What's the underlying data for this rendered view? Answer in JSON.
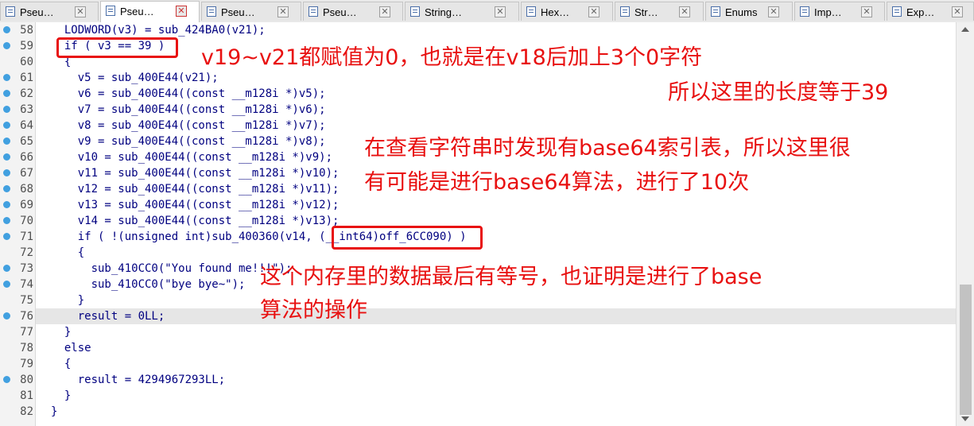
{
  "tabs": [
    {
      "label": "Pseu…",
      "active": false
    },
    {
      "label": "Pseu…",
      "active": true
    },
    {
      "label": "Pseu…",
      "active": false
    },
    {
      "label": "Pseu…",
      "active": false
    },
    {
      "label": "String…",
      "active": false
    },
    {
      "label": "Hex…",
      "active": false
    },
    {
      "label": "Str…",
      "active": false
    },
    {
      "label": "Enums",
      "active": false
    },
    {
      "label": "Imp…",
      "active": false
    },
    {
      "label": "Exp…",
      "active": false
    }
  ],
  "tab_close_glyph": "✕",
  "code_lines": [
    {
      "num": "58",
      "text": "  LODWORD(v3) = sub_424BA0(v21);",
      "bp": true
    },
    {
      "num": "59",
      "text": "  if ( v3 == 39 )",
      "bp": true
    },
    {
      "num": "60",
      "text": "  {",
      "bp": false
    },
    {
      "num": "61",
      "text": "    v5 = sub_400E44(v21);",
      "bp": true
    },
    {
      "num": "62",
      "text": "    v6 = sub_400E44((const __m128i *)v5);",
      "bp": true
    },
    {
      "num": "63",
      "text": "    v7 = sub_400E44((const __m128i *)v6);",
      "bp": true
    },
    {
      "num": "64",
      "text": "    v8 = sub_400E44((const __m128i *)v7);",
      "bp": true
    },
    {
      "num": "65",
      "text": "    v9 = sub_400E44((const __m128i *)v8);",
      "bp": true
    },
    {
      "num": "66",
      "text": "    v10 = sub_400E44((const __m128i *)v9);",
      "bp": true
    },
    {
      "num": "67",
      "text": "    v11 = sub_400E44((const __m128i *)v10);",
      "bp": true
    },
    {
      "num": "68",
      "text": "    v12 = sub_400E44((const __m128i *)v11);",
      "bp": true
    },
    {
      "num": "69",
      "text": "    v13 = sub_400E44((const __m128i *)v12);",
      "bp": true
    },
    {
      "num": "70",
      "text": "    v14 = sub_400E44((const __m128i *)v13);",
      "bp": true
    },
    {
      "num": "71",
      "text": "    if ( !(unsigned int)sub_400360(v14, (__int64)off_6CC090) )",
      "bp": true
    },
    {
      "num": "72",
      "text": "    {",
      "bp": false
    },
    {
      "num": "73",
      "text": "      sub_410CC0(\"You found me!!!\");",
      "bp": true
    },
    {
      "num": "74",
      "text": "      sub_410CC0(\"bye bye~\");",
      "bp": true
    },
    {
      "num": "75",
      "text": "    }",
      "bp": false
    },
    {
      "num": "76",
      "text": "    result = 0LL;",
      "bp": true,
      "highlight": true
    },
    {
      "num": "77",
      "text": "  }",
      "bp": false
    },
    {
      "num": "78",
      "text": "  else",
      "bp": false
    },
    {
      "num": "79",
      "text": "  {",
      "bp": false
    },
    {
      "num": "80",
      "text": "    result = 4294967293LL;",
      "bp": true
    },
    {
      "num": "81",
      "text": "  }",
      "bp": false
    },
    {
      "num": "82",
      "text": "}",
      "bp": false
    }
  ],
  "annotations": {
    "a1": "v19~v21都赋值为0，也就是在v18后加上3个0字符",
    "a2": "所以这里的长度等于39",
    "a3": "在查看字符串时发现有base64索引表，所以这里很",
    "a4": "有可能是进行base64算法，进行了10次",
    "a5": "这个内存里的数据最后有等号，也证明是进行了base",
    "a6": "算法的操作"
  },
  "colors": {
    "annotation": "#e81010",
    "breakpoint": "#41a0e0",
    "code": "#000080"
  }
}
